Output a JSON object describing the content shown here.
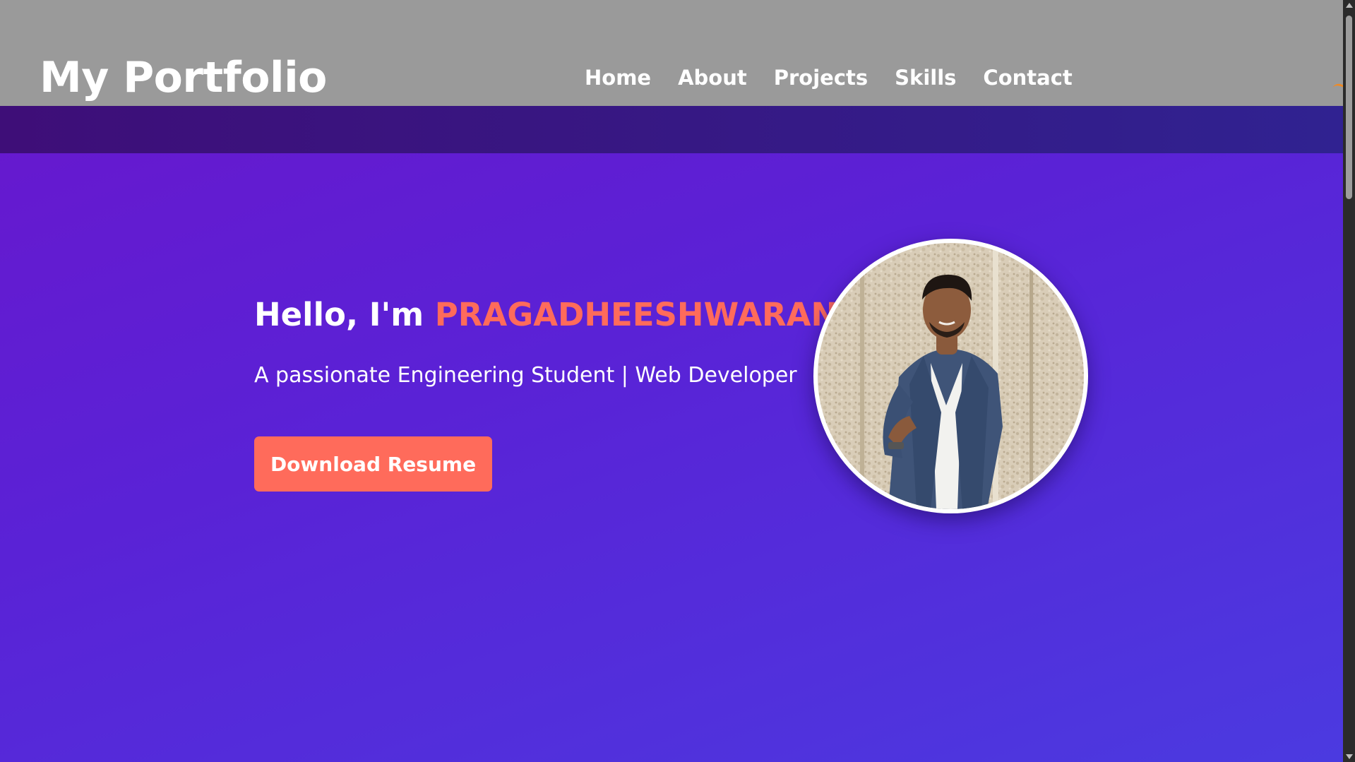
{
  "navbar": {
    "logo": "My Portfolio",
    "links": [
      "Home",
      "About",
      "Projects",
      "Skills",
      "Contact"
    ]
  },
  "hero": {
    "greeting": "Hello, I'm ",
    "name": "PRAGADHEESHWARAN",
    "subtitle": "A passionate Engineering Student | Web Developer",
    "button_label": "Download Resume"
  },
  "colors": {
    "accent": "#ff6b5b",
    "navbar_bg": "#9a9a9a",
    "hero_gradient_start": "#6a16cc",
    "hero_gradient_end": "#4b3ae0"
  }
}
